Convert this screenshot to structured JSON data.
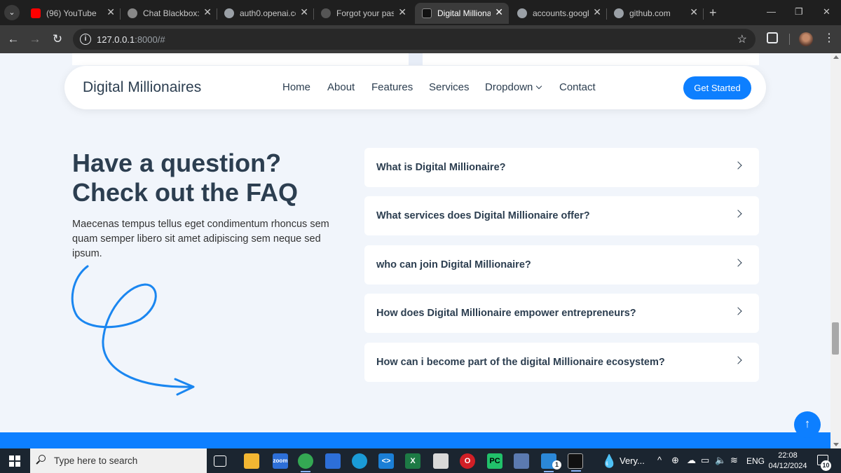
{
  "browser": {
    "tabs": [
      {
        "title": "(96) YouTube",
        "favicon_color": "#ff0000"
      },
      {
        "title": "Chat Blackbox: A",
        "favicon_color": "#888888"
      },
      {
        "title": "auth0.openai.co",
        "favicon_color": "#9aa0a6"
      },
      {
        "title": "Forgot your pas",
        "favicon_color": "#555555"
      },
      {
        "title": "Digital Millionai",
        "favicon_color": "#111111"
      },
      {
        "title": "accounts.google.",
        "favicon_color": "#9aa0a6"
      },
      {
        "title": "github.com",
        "favicon_color": "#9aa0a6"
      }
    ],
    "active_tab_index": 4,
    "url_host": "127.0.0.1",
    "url_rest": ":8000/#"
  },
  "site": {
    "brand": "Digital Millionaires",
    "nav": {
      "home": "Home",
      "about": "About",
      "features": "Features",
      "services": "Services",
      "dropdown": "Dropdown",
      "contact": "Contact"
    },
    "cta_label": "Get Started",
    "accent_color": "#0d7fff"
  },
  "faq": {
    "heading_line1": "Have a question?",
    "heading_line2": "Check out the FAQ",
    "description": "Maecenas tempus tellus eget condimentum rhoncus sem quam semper libero sit amet adipiscing sem neque sed ipsum.",
    "items": [
      {
        "question": "What is Digital Millionaire?"
      },
      {
        "question": "What services does Digital Millionaire offer?"
      },
      {
        "question": "who can join Digital Millionaire?"
      },
      {
        "question": "How does Digital Millionaire empower entrepreneurs?"
      },
      {
        "question": "How can i become part of the digital Millionaire ecosystem?"
      }
    ]
  },
  "taskbar": {
    "search_placeholder": "Type here to search",
    "weather_text": "Very...",
    "language": "ENG",
    "time": "22:08",
    "date": "04/12/2024",
    "mail_badge": "1",
    "notification_count": "10"
  }
}
